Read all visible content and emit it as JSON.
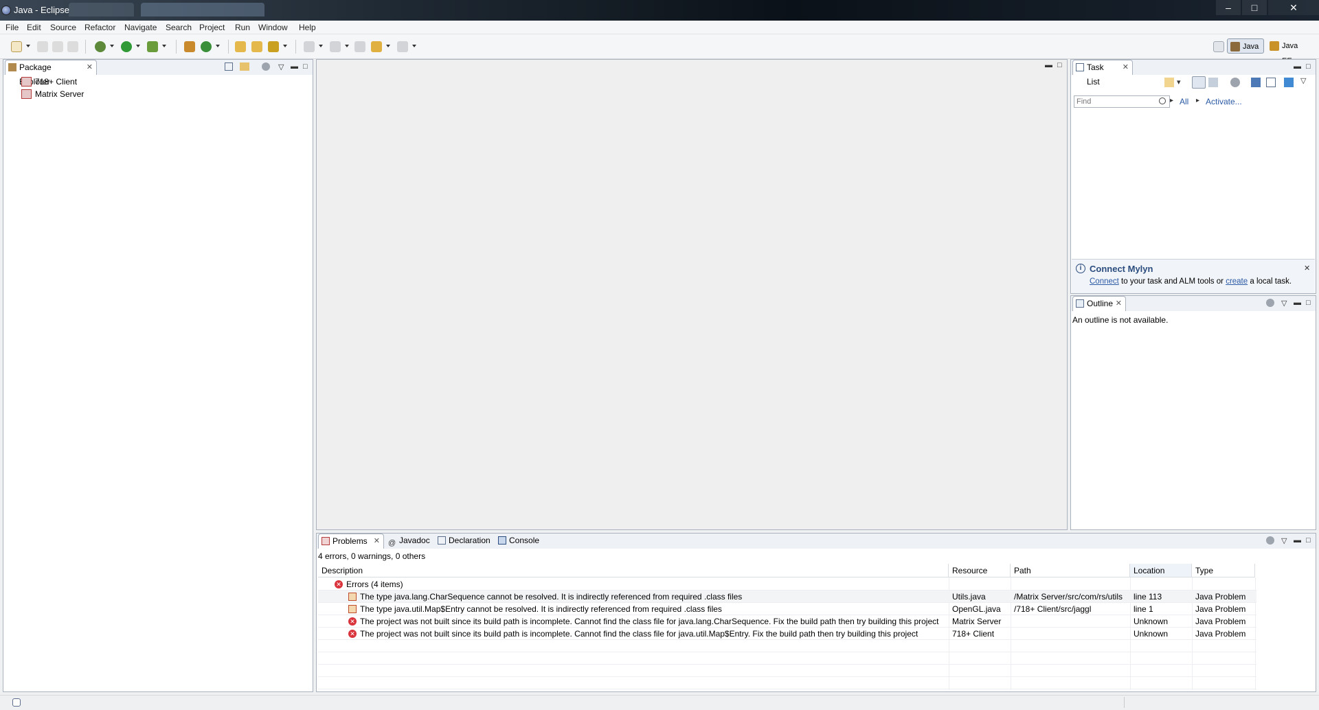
{
  "window": {
    "title": "Java - Eclipse",
    "controls": {
      "minimize": "–",
      "maximize": "□",
      "close": "✕"
    }
  },
  "menu": [
    "File",
    "Edit",
    "Source",
    "Refactor",
    "Navigate",
    "Search",
    "Project",
    "Run",
    "Window",
    "Help"
  ],
  "perspectives": {
    "java": "Java",
    "javaee": "Java EE"
  },
  "package_explorer": {
    "tab_label": "Package Explorer",
    "projects": [
      "718+ Client",
      "Matrix Server"
    ]
  },
  "task_list": {
    "tab_label": "Task List",
    "find_placeholder": "Find",
    "filter_all": "All",
    "activate": "Activate...",
    "mylyn": {
      "title": "Connect Mylyn",
      "connect_link": "Connect",
      "text_middle": " to your task and ALM tools or ",
      "create_link": "create",
      "text_end": " a local task."
    }
  },
  "outline": {
    "tab_label": "Outline",
    "message": "An outline is not available."
  },
  "bottom_tabs": {
    "problems": "Problems",
    "javadoc": "Javadoc",
    "declaration": "Declaration",
    "console": "Console"
  },
  "problems": {
    "summary": "4 errors, 0 warnings, 0 others",
    "columns": [
      "Description",
      "Resource",
      "Path",
      "Location",
      "Type"
    ],
    "group_label": "Errors (4 items)",
    "rows": [
      {
        "description": "The type java.lang.CharSequence cannot be resolved. It is indirectly referenced from required .class files",
        "resource": "Utils.java",
        "path": "/Matrix Server/src/com/rs/utils",
        "location": "line 113",
        "type": "Java Problem"
      },
      {
        "description": "The type java.util.Map$Entry cannot be resolved. It is indirectly referenced from required .class files",
        "resource": "OpenGL.java",
        "path": "/718+ Client/src/jaggl",
        "location": "line 1",
        "type": "Java Problem"
      },
      {
        "description": "The project was not built since its build path is incomplete. Cannot find the class file for java.lang.CharSequence. Fix the build path then try building this project",
        "resource": "Matrix Server",
        "path": "",
        "location": "Unknown",
        "type": "Java Problem"
      },
      {
        "description": "The project was not built since its build path is incomplete. Cannot find the class file for java.util.Map$Entry. Fix the build path then try building this project",
        "resource": "718+ Client",
        "path": "",
        "location": "Unknown",
        "type": "Java Problem"
      }
    ]
  },
  "colors": {
    "accent": "#2a59a5",
    "error": "#d9343c",
    "panel_border": "#a9b2bd"
  }
}
